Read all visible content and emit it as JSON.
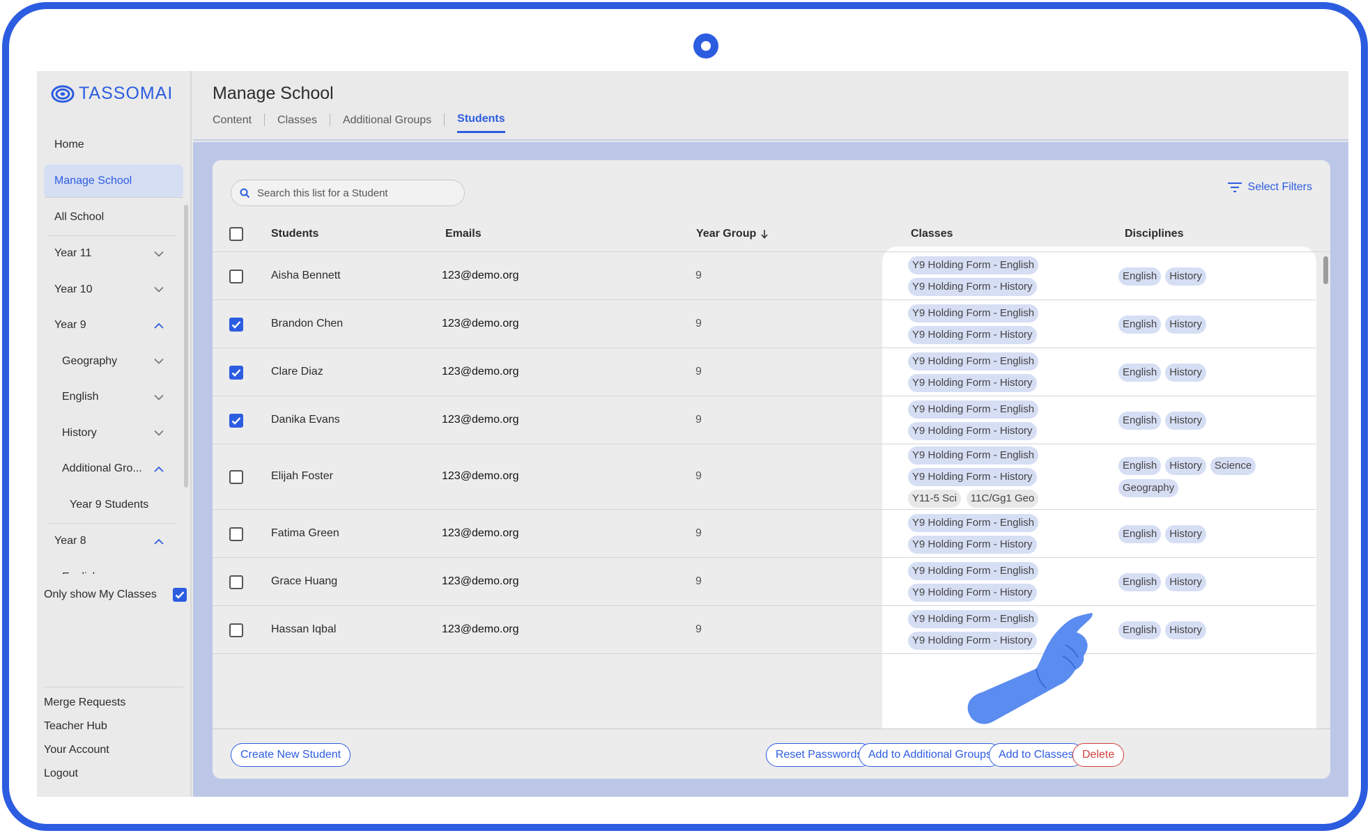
{
  "brand": {
    "name": "TASSOMAI",
    "color": "#2c5ce0"
  },
  "sidebar": {
    "nav": [
      {
        "label": "Home",
        "active": false
      },
      {
        "label": "Manage School",
        "active": true
      }
    ],
    "tree": [
      {
        "label": "All School",
        "level": 1,
        "chevron": ""
      },
      {
        "label": "Year 11",
        "level": 1,
        "chevron": "down"
      },
      {
        "label": "Year 10",
        "level": 1,
        "chevron": "down"
      },
      {
        "label": "Year 9",
        "level": 1,
        "chevron": "up"
      },
      {
        "label": "Geography",
        "level": 2,
        "chevron": "down"
      },
      {
        "label": "English",
        "level": 2,
        "chevron": "down"
      },
      {
        "label": "History",
        "level": 2,
        "chevron": "down"
      },
      {
        "label": "Additional Gro...",
        "level": 2,
        "chevron": "up"
      },
      {
        "label": "Year 9 Students",
        "level": 3,
        "chevron": ""
      },
      {
        "label": "Year 8",
        "level": 1,
        "chevron": "up"
      },
      {
        "label": "English",
        "level": 2,
        "chevron": "down"
      }
    ],
    "only_mine_label": "Only show My Classes",
    "only_mine_checked": true,
    "bottom_links": [
      "Merge Requests",
      "Teacher Hub",
      "Your Account",
      "Logout"
    ]
  },
  "header": {
    "title": "Manage School",
    "tabs": [
      {
        "label": "Content",
        "active": false
      },
      {
        "label": "Classes",
        "active": false
      },
      {
        "label": "Additional Groups",
        "active": false
      },
      {
        "label": "Students",
        "active": true
      }
    ]
  },
  "search": {
    "placeholder": "Search this list for a Student"
  },
  "filters_label": "Select Filters",
  "table": {
    "columns": {
      "students": "Students",
      "emails": "Emails",
      "year_group": "Year Group",
      "classes": "Classes",
      "disciplines": "Disciplines"
    },
    "rows": [
      {
        "name": "Aisha Bennett",
        "email": "123@demo.org",
        "year": "9",
        "checked": false,
        "classes": [
          [
            "Y9 Holding Form - English"
          ],
          [
            "Y9 Holding Form - History"
          ]
        ],
        "disciplines": [
          "English",
          "History"
        ]
      },
      {
        "name": "Brandon Chen",
        "email": "123@demo.org",
        "year": "9",
        "checked": true,
        "classes": [
          [
            "Y9 Holding Form - English"
          ],
          [
            "Y9 Holding Form - History"
          ]
        ],
        "disciplines": [
          "English",
          "History"
        ]
      },
      {
        "name": "Clare Diaz",
        "email": "123@demo.org",
        "year": "9",
        "checked": true,
        "classes": [
          [
            "Y9 Holding Form - English"
          ],
          [
            "Y9 Holding Form - History"
          ]
        ],
        "disciplines": [
          "English",
          "History"
        ]
      },
      {
        "name": "Danika Evans",
        "email": "123@demo.org",
        "year": "9",
        "checked": true,
        "classes": [
          [
            "Y9 Holding Form - English"
          ],
          [
            "Y9 Holding Form - History"
          ]
        ],
        "disciplines": [
          "English",
          "History"
        ]
      },
      {
        "name": "Elijah Foster",
        "email": "123@demo.org",
        "year": "9",
        "checked": false,
        "classes": [
          [
            "Y9 Holding Form - English"
          ],
          [
            "Y9 Holding Form - History"
          ],
          [
            "Y11-5 Sci",
            "11C/Gg1 Geo"
          ]
        ],
        "disciplines": [
          "English",
          "History",
          "Science",
          "Geography"
        ]
      },
      {
        "name": "Fatima Green",
        "email": "123@demo.org",
        "year": "9",
        "checked": false,
        "classes": [
          [
            "Y9 Holding Form - English"
          ],
          [
            "Y9 Holding Form - History"
          ]
        ],
        "disciplines": [
          "English",
          "History"
        ]
      },
      {
        "name": "Grace Huang",
        "email": "123@demo.org",
        "year": "9",
        "checked": false,
        "classes": [
          [
            "Y9 Holding Form - English"
          ],
          [
            "Y9 Holding Form - History"
          ]
        ],
        "disciplines": [
          "English",
          "History"
        ]
      },
      {
        "name": "Hassan Iqbal",
        "email": "123@demo.org",
        "year": "9",
        "checked": false,
        "classes": [
          [
            "Y9 Holding Form - English"
          ],
          [
            "Y9 Holding Form - History"
          ]
        ],
        "disciplines": [
          "English",
          "History"
        ]
      }
    ]
  },
  "footer": {
    "create": "Create New Student",
    "reset": "Reset Passwords",
    "add_groups": "Add to Additional Groups",
    "add_classes": "Add to Classes",
    "delete": "Delete"
  },
  "colors": {
    "accent": "#2c5ce0",
    "chip": "#d6def4",
    "danger": "#d23c3c",
    "content_bg": "#bcc7e8"
  }
}
